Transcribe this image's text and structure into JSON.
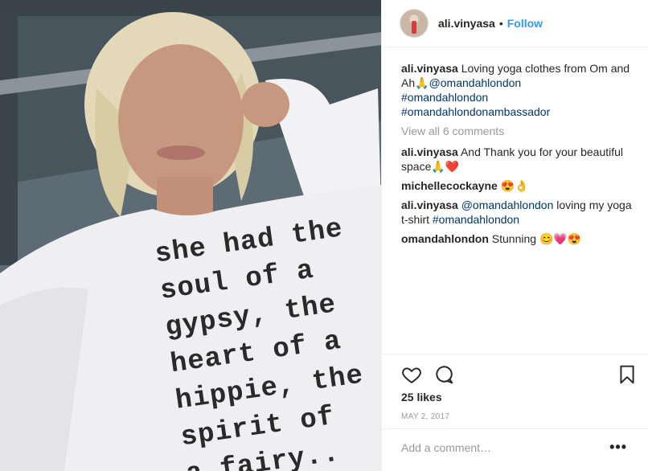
{
  "photo": {
    "shirt_text": "she had the\nsoul of a\ngypsy, the\nheart of a\nhippie, the\nspirit of\na fairy..",
    "description_icon": "photo-of-person"
  },
  "header": {
    "username": "ali.vinyasa",
    "separator": "•",
    "follow_label": "Follow"
  },
  "caption": {
    "user": "ali.vinyasa",
    "text": "Loving yoga clothes from Om and Ah🙏",
    "mention": "@omandahlondon",
    "hashtags": [
      "#omandahlondon",
      "#omandahlondonambassador"
    ]
  },
  "view_all": "View all 6 comments",
  "comments": [
    {
      "user": "ali.vinyasa",
      "text": "And Thank you for your beautiful space🙏❤️"
    },
    {
      "user": "michellecockayne",
      "text": "😍👌"
    },
    {
      "user": "ali.vinyasa",
      "mention": "@omandahlondon",
      "text": "loving my yoga t-shirt",
      "hashtag": "#omandahlondon"
    },
    {
      "user": "omandahlondon",
      "text": "Stunning 😊💗😍"
    }
  ],
  "likes": "25 likes",
  "date": "MAY 2, 2017",
  "add_comment_placeholder": "Add a comment…",
  "more_label": "•••",
  "icons": {
    "like": "heart-icon",
    "comment": "comment-bubble-icon",
    "save": "bookmark-icon"
  },
  "colors": {
    "link": "#3897f0",
    "tag": "#003569",
    "muted": "#999999"
  }
}
